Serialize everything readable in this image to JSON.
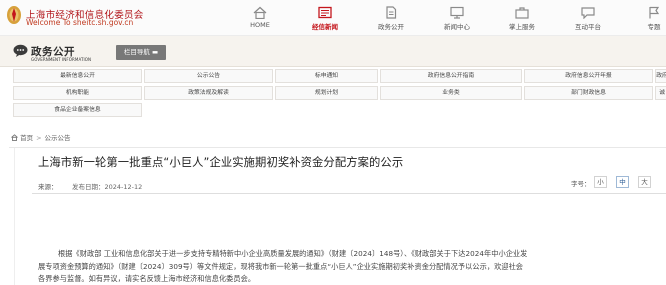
{
  "header": {
    "site_name_cn": "上海市经济和信息化委员会",
    "site_name_en": "Welcome To sheitc.sh.gov.cn",
    "nav": [
      {
        "label": "HOME",
        "icon": "house-icon",
        "active": false
      },
      {
        "label": "经信新闻",
        "icon": "newspaper-icon",
        "active": true
      },
      {
        "label": "政务公开",
        "icon": "document-icon",
        "active": false
      },
      {
        "label": "新闻中心",
        "icon": "monitor-icon",
        "active": false
      },
      {
        "label": "掌上服务",
        "icon": "briefcase-icon",
        "active": false
      },
      {
        "label": "互动平台",
        "icon": "chat-icon",
        "active": false
      },
      {
        "label": "专题",
        "icon": "flag-icon",
        "active": false
      }
    ]
  },
  "section": {
    "title_cn": "政务公开",
    "title_en": "GOVERNMENT INFORMATION",
    "guide_button": "栏目导航"
  },
  "categories": {
    "row1": [
      "最新信息公开",
      "公示公告",
      "标申通知",
      "政府信息公开指南",
      "政府信息公开年报",
      "政府"
    ],
    "row2": [
      "机构职能",
      "政策法规及解读",
      "规划计划",
      "业务类",
      "部门财政信息",
      "诚"
    ],
    "row3": [
      "食品企业备案信息"
    ]
  },
  "breadcrumb": {
    "home": "首页",
    "separator": ">",
    "current": "公示公告"
  },
  "article": {
    "title": "上海市新一轮第一批重点“小巨人”企业实施期初奖补资金分配方案的公示",
    "source_label": "来源：",
    "date": "发布日期：2024-12-12",
    "font_size_label": "字号：",
    "font_sizes": [
      "小",
      "中",
      "大"
    ],
    "paragraph_lines": [
      "根据《财政部 工业和信息化部关于进一步支持专精特新中小企业高质量发展的通知》（财建〔2024〕148号）、《财政部关于下达2024年中小企业发",
      "展专项资金预算的通知》（财建〔2024〕309号）等文件规定，现将我市新一轮第一批重点“小巨人”企业实施期初奖补资金分配情况予以公示，欢迎社会",
      "各界参与监督。如有异议，请实名反馈上海市经济和信息化委员会。"
    ]
  },
  "colors": {
    "brand_red": "#c4161c",
    "strip_bg": "#f6f3ee",
    "guide_button_bg": "#787878"
  }
}
